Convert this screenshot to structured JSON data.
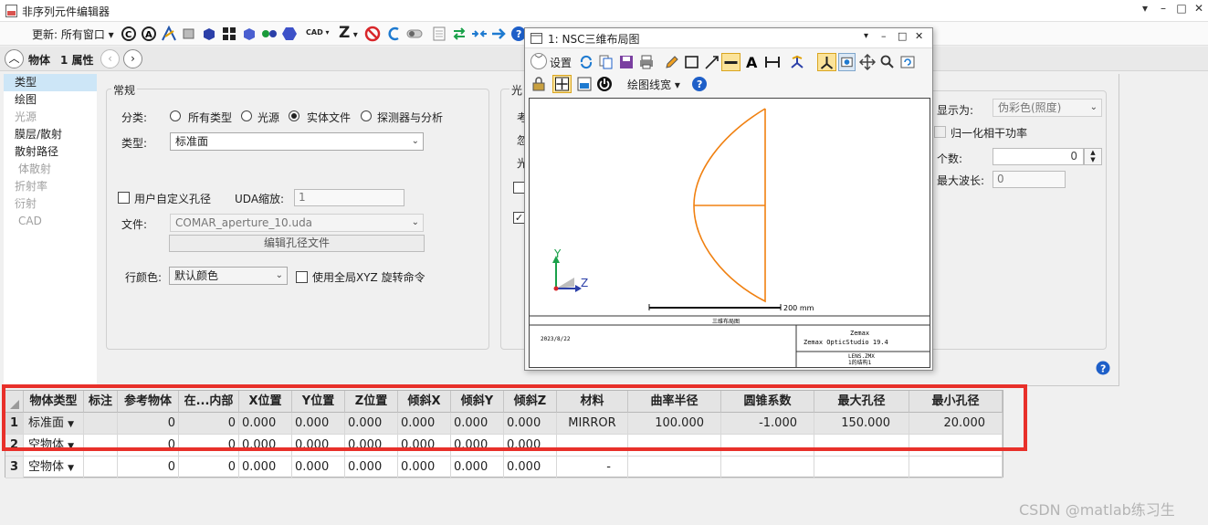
{
  "app": {
    "title": "非序列元件编辑器"
  },
  "toolbar": {
    "update_label": "更新: 所有窗口",
    "cad_label": "CAD",
    "z_label": "Z"
  },
  "navbar": {
    "object_label": "物体",
    "property_label": "1 属性"
  },
  "left_nav": {
    "items": [
      {
        "label": "类型",
        "state": "selected"
      },
      {
        "label": "绘图",
        "state": "normal"
      },
      {
        "label": "光源",
        "state": "disabled"
      },
      {
        "label": "膜层/散射",
        "state": "normal"
      },
      {
        "label": "散射路径",
        "state": "normal"
      },
      {
        "label": "体散射",
        "state": "disabled"
      },
      {
        "label": "折射率",
        "state": "disabled"
      },
      {
        "label": "衍射",
        "state": "disabled"
      },
      {
        "label": "CAD",
        "state": "disabled"
      }
    ]
  },
  "general": {
    "group_title": "常规",
    "category_label": "分类:",
    "radio_all": "所有类型",
    "radio_source": "光源",
    "radio_solid": "实体文件",
    "radio_detector": "探测器与分析",
    "type_label": "类型:",
    "type_value": "标准面",
    "uda_checkbox": "用户自定义孔径",
    "uda_scale_label": "UDA缩放:",
    "uda_scale_value": "1",
    "file_label": "文件:",
    "file_value": "COMAR_aperture_10.uda",
    "edit_aperture_button": "编辑孔径文件",
    "row_color_label": "行颜色:",
    "row_color_value": "默认颜色",
    "global_xyz_checkbox": "使用全局XYZ 旋转命令"
  },
  "second_group": {
    "title_fragment": "光",
    "row1": "考",
    "row2": "忽",
    "row3": "光"
  },
  "right_panel": {
    "display_label": "显示为:",
    "display_value": "伪彩色(照度)",
    "normalize_label": "归一化相干功率",
    "count_label": "个数:",
    "count_value": "0",
    "max_wave_label": "最大波长:",
    "max_wave_value": "0"
  },
  "layout_window": {
    "title": "1: NSC三维布局图",
    "settings_label": "设置",
    "line_width_label": "绘图线宽",
    "axis_y": "Y",
    "axis_z": "Z",
    "scale_label": "200 mm",
    "plot_title": "三维布局图",
    "date": "2023/8/22",
    "company": "Zemax",
    "product": "Zemax OpticStudio 19.4",
    "file": "LENS.ZMX",
    "config": "1的结构1",
    "curve_color": "#f08010"
  },
  "table": {
    "headers": [
      "物体类型",
      "标注",
      "参考物体",
      "在...内部",
      "X位置",
      "Y位置",
      "Z位置",
      "倾斜X",
      "倾斜Y",
      "倾斜Z",
      "材料",
      "曲率半径",
      "圆锥系数",
      "最大孔径",
      "最小孔径"
    ],
    "rows": [
      {
        "num": "1",
        "type": "标准面",
        "comment": "",
        "ref": "0",
        "inside": "0",
        "x": "0.000",
        "y": "0.000",
        "z": "0.000",
        "tx": "0.000",
        "ty": "0.000",
        "tz": "0.000",
        "material": "MIRROR",
        "radius": "100.000",
        "conic": "-1.000",
        "max_ap": "150.000",
        "min_ap": "20.000"
      },
      {
        "num": "2",
        "type": "空物体",
        "comment": "",
        "ref": "0",
        "inside": "0",
        "x": "0.000",
        "y": "0.000",
        "z": "0.000",
        "tx": "0.000",
        "ty": "0.000",
        "tz": "0.000",
        "material": "",
        "radius": "",
        "conic": "",
        "max_ap": "",
        "min_ap": ""
      },
      {
        "num": "3",
        "type": "空物体",
        "comment": "",
        "ref": "0",
        "inside": "0",
        "x": "0.000",
        "y": "0.000",
        "z": "0.000",
        "tx": "0.000",
        "ty": "0.000",
        "tz": "0.000",
        "material": "-",
        "radius": "",
        "conic": "",
        "max_ap": "",
        "min_ap": ""
      }
    ]
  },
  "watermark": "CSDN @matlab练习生",
  "highlight_color": "#e8302a"
}
